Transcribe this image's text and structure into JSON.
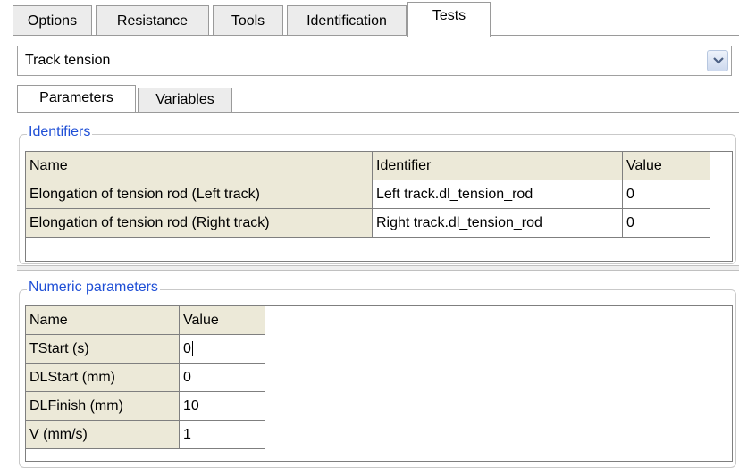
{
  "tabs": [
    "Options",
    "Resistance",
    "Tools",
    "Identification",
    "Tests"
  ],
  "active_tab": "Tests",
  "test_select": {
    "value": "Track tension"
  },
  "subtabs": [
    "Parameters",
    "Variables"
  ],
  "active_subtab": "Parameters",
  "identifiers": {
    "legend": "Identifiers",
    "columns": [
      "Name",
      "Identifier",
      "Value"
    ],
    "rows": [
      [
        "Elongation of tension rod (Left track)",
        "Left track.dl_tension_rod",
        "0"
      ],
      [
        "Elongation of tension rod (Right track)",
        "Right track.dl_tension_rod",
        "0"
      ]
    ]
  },
  "numeric": {
    "legend": "Numeric parameters",
    "columns": [
      "Name",
      "Value"
    ],
    "rows": [
      [
        "TStart (s)",
        "0"
      ],
      [
        "DLStart (mm)",
        "0"
      ],
      [
        "DLFinish (mm)",
        "10"
      ],
      [
        "V (mm/s)",
        "1"
      ]
    ]
  },
  "colors": {
    "legend": "#1f4fd6",
    "header_bg": "#ece9d8",
    "border": "#7f7f7f"
  },
  "icons": {
    "dropdown": "chevron-down-icon"
  }
}
